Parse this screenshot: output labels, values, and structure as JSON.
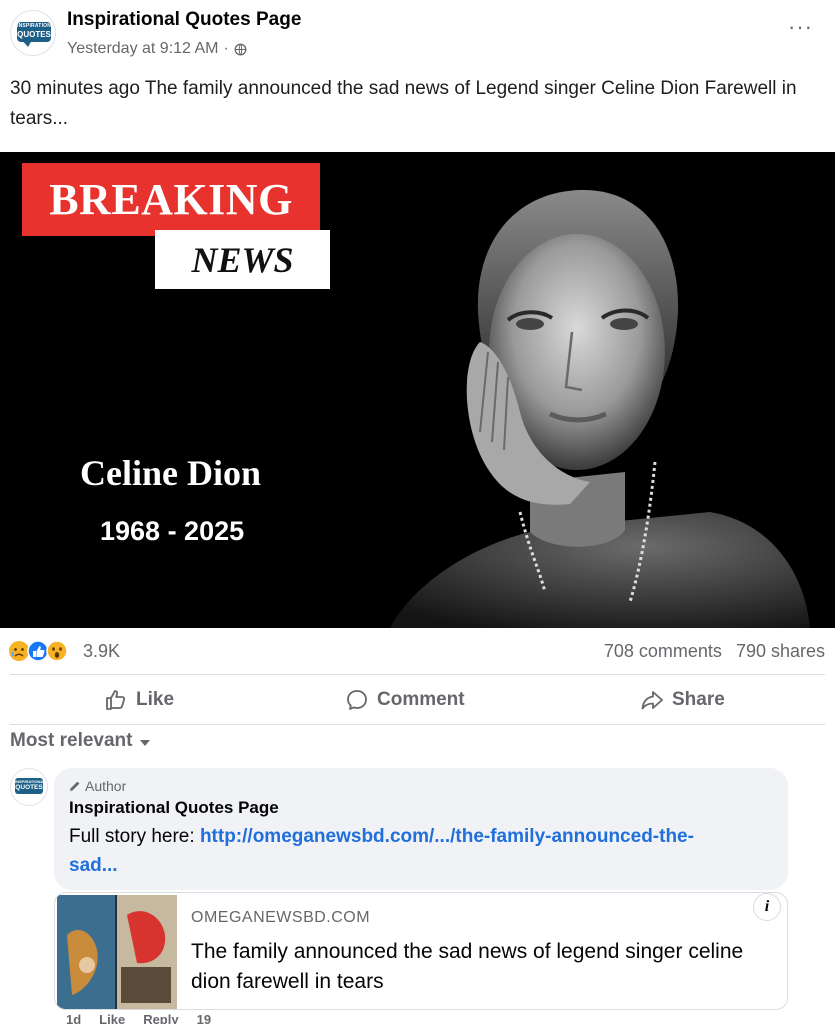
{
  "post": {
    "page_name": "Inspirational Quotes Page",
    "timestamp": "Yesterday at 9:12 AM",
    "meta_separator": "·",
    "more_label": "···",
    "caption": "30 minutes ago  The family announced the sad news of Legend singer Celine Dion  Farewell in tears...",
    "avatar_text_top": "INSPIRATIONAL",
    "avatar_text_bottom": "QUOTES"
  },
  "media": {
    "breaking_label": "BREAKING",
    "news_label": "NEWS",
    "subject_name": "Celine Dion",
    "subject_years": "1968 - 2025"
  },
  "stats": {
    "reaction_icons": [
      "sad-reaction-icon",
      "like-reaction-icon",
      "wow-reaction-icon"
    ],
    "reaction_count": "3.9K",
    "comments": "708 comments",
    "shares": "790 shares"
  },
  "actions": {
    "like": "Like",
    "comment": "Comment",
    "share": "Share"
  },
  "comments": {
    "sort_label": "Most relevant",
    "top_comment": {
      "badge": "Author",
      "author": "Inspirational Quotes Page",
      "text_prefix": "Full story here: ",
      "link": "http://omeganewsbd.com/.../the-family-announced-the-sad...",
      "card": {
        "domain": "OMEGANEWSBD.COM",
        "title": "The family announced the sad news of legend singer celine dion farewell in tears",
        "info_label": "i"
      },
      "footer": {
        "age": "1d",
        "like": "Like",
        "reply": "Reply",
        "reactions": "19"
      }
    }
  },
  "colors": {
    "breaking_red": "#e8322e",
    "link_blue": "#216fdb",
    "muted_text": "#65676b",
    "bubble_bg": "#f0f2f5"
  }
}
